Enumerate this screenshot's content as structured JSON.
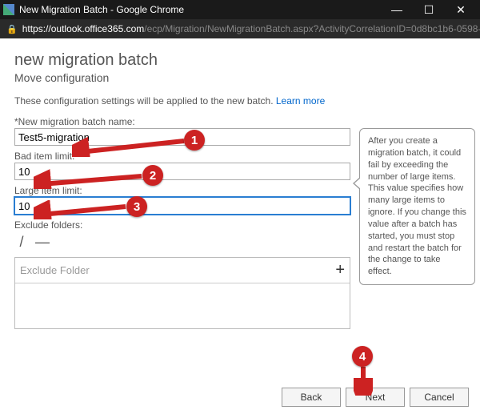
{
  "window": {
    "title": "New Migration Batch - Google Chrome"
  },
  "addressbar": {
    "host": "https://outlook.office365.com",
    "path": "/ecp/Migration/NewMigrationBatch.aspx?ActivityCorrelationID=0d8bc1b6-0598-3..."
  },
  "page": {
    "heading": "new migration batch",
    "subtitle": "Move configuration",
    "description_pre": "These configuration settings will be applied to the new batch. ",
    "learn_more": "Learn more"
  },
  "form": {
    "batch_name_label": "*New migration batch name:",
    "batch_name_value": "Test5-migration",
    "bad_item_label": "Bad item limit:",
    "bad_item_value": "10",
    "large_item_label": "Large item limit:",
    "large_item_value": "10",
    "exclude_label": "Exclude folders:",
    "exclude_placeholder": "Exclude Folder"
  },
  "tooltip": {
    "text": "After you create a migration batch, it could fail by exceeding the number of large items. This value specifies how many large items to ignore. If you change this value after a batch has started, you must stop and restart the batch for the change to take effect."
  },
  "buttons": {
    "back": "Back",
    "next": "Next",
    "cancel": "Cancel"
  },
  "annotations": {
    "b1": "1",
    "b2": "2",
    "b3": "3",
    "b4": "4"
  }
}
